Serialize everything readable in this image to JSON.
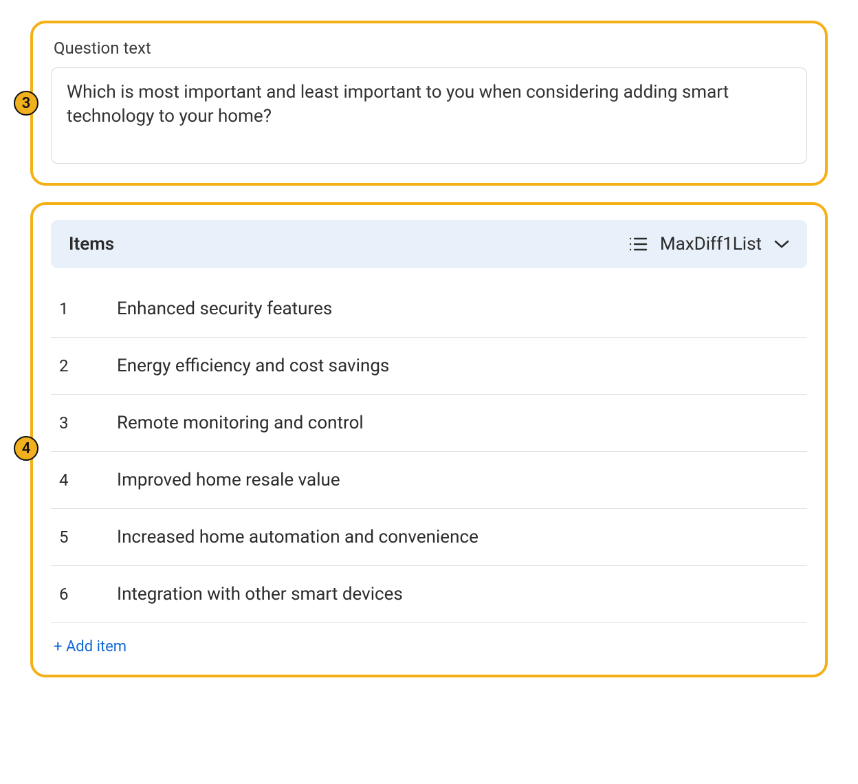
{
  "callouts": {
    "step3": "3",
    "step4": "4"
  },
  "question": {
    "label": "Question text",
    "text": "Which is most important and least important to you when considering adding smart technology to your home?"
  },
  "items_panel": {
    "header_title": "Items",
    "list_selector_label": "MaxDiff1List",
    "add_item_label": "+ Add item",
    "rows": [
      {
        "num": "1",
        "text": "Enhanced security features"
      },
      {
        "num": "2",
        "text": "Energy efficiency and cost savings"
      },
      {
        "num": "3",
        "text": "Remote monitoring and control"
      },
      {
        "num": "4",
        "text": "Improved home resale value"
      },
      {
        "num": "5",
        "text": "Increased home automation and convenience"
      },
      {
        "num": "6",
        "text": "Integration with other smart devices"
      }
    ]
  }
}
